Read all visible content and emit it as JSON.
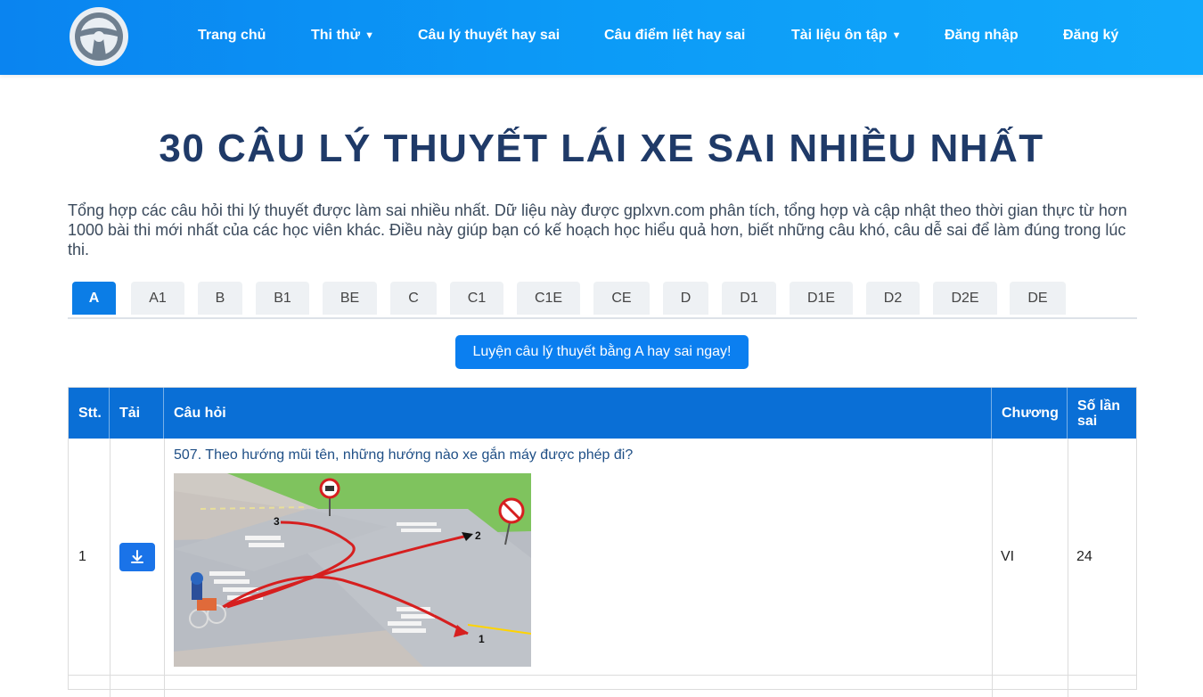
{
  "nav": {
    "items": [
      {
        "label": "Trang chủ",
        "dropdown": false
      },
      {
        "label": "Thi thử",
        "dropdown": true
      },
      {
        "label": "Câu lý thuyết hay sai",
        "dropdown": false
      },
      {
        "label": "Câu điểm liệt hay sai",
        "dropdown": false
      },
      {
        "label": "Tài liệu ôn tập",
        "dropdown": true
      },
      {
        "label": "Đăng nhập",
        "dropdown": false
      },
      {
        "label": "Đăng ký",
        "dropdown": false
      }
    ]
  },
  "page": {
    "title": "30 CÂU LÝ THUYẾT LÁI XE SAI NHIỀU NHẤT",
    "description": "Tổng hợp các câu hỏi thi lý thuyết được làm sai nhiều nhất. Dữ liệu này được gplxvn.com phân tích, tổng hợp và cập nhật theo thời gian thực từ hơn 1000 bài thi mới nhất của các học viên khác. Điều này giúp bạn có kế hoạch học hiểu quả hơn, biết những câu khó, câu dễ sai để làm đúng trong lúc thi."
  },
  "tabs": [
    "A",
    "A1",
    "B",
    "B1",
    "BE",
    "C",
    "C1",
    "C1E",
    "CE",
    "D",
    "D1",
    "D1E",
    "D2",
    "D2E",
    "DE"
  ],
  "active_tab": "A",
  "cta_label": "Luyện câu lý thuyết bằng A hay sai ngay!",
  "table": {
    "headers": {
      "stt": "Stt.",
      "tai": "Tải",
      "question": "Câu hỏi",
      "chapter": "Chương",
      "wrong_count": "Số lần sai"
    },
    "rows": [
      {
        "stt": "1",
        "question": "507. Theo hướng mũi tên, những hướng nào xe gắn máy được phép đi?",
        "chapter": "VI",
        "wrong_count": "24"
      }
    ]
  },
  "figure": {
    "labels": [
      "1",
      "2",
      "3"
    ]
  },
  "colors": {
    "header": "#0c9bf7",
    "tab_active": "#0b7de6",
    "table_head": "#0a6fd6",
    "title": "#1f3a68"
  }
}
